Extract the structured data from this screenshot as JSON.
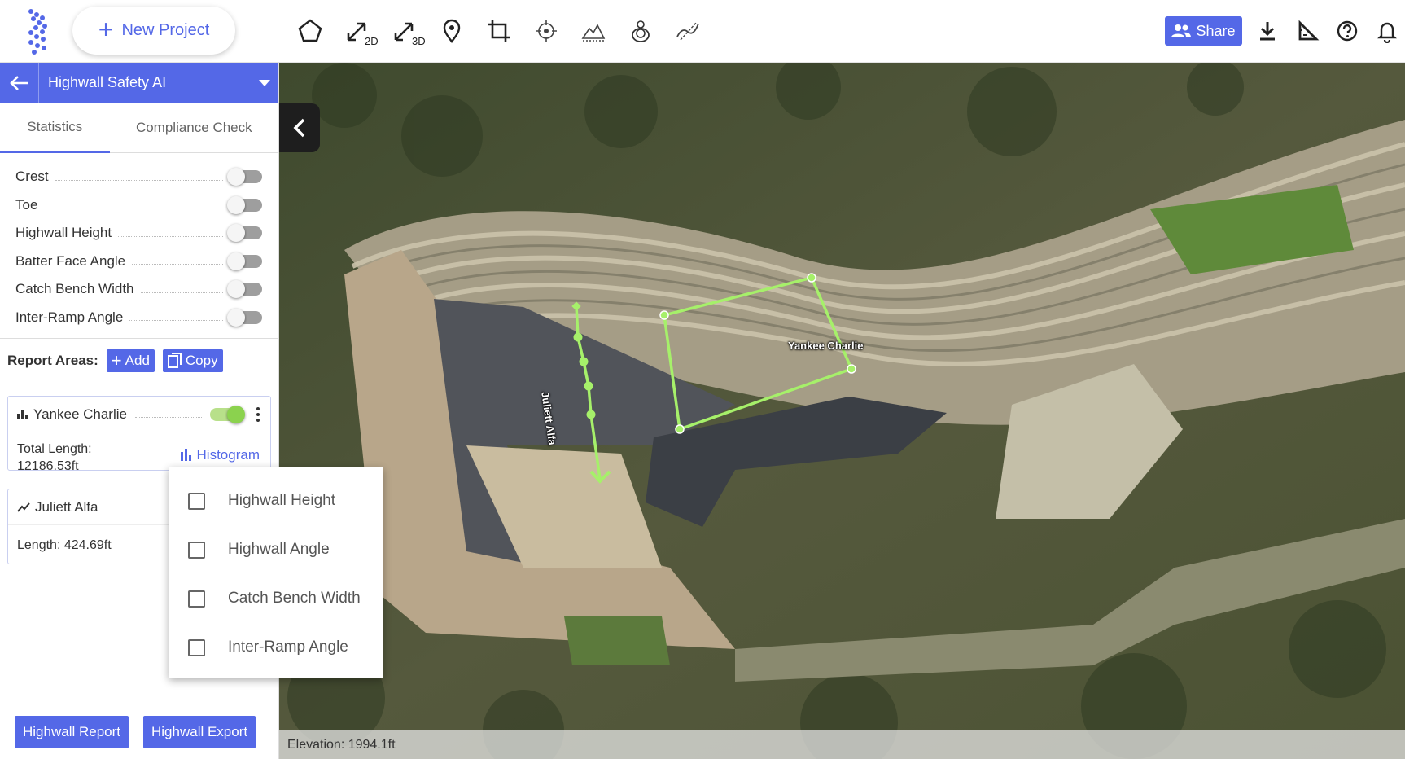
{
  "topbar": {
    "new_project_label": "New Project",
    "tools": [
      {
        "name": "polygon-tool-icon",
        "sub": ""
      },
      {
        "name": "measure-2d-icon",
        "sub": "2D"
      },
      {
        "name": "measure-3d-icon",
        "sub": "3D"
      },
      {
        "name": "location-pin-icon",
        "sub": ""
      },
      {
        "name": "crop-icon",
        "sub": ""
      },
      {
        "name": "target-icon",
        "sub": ""
      },
      {
        "name": "volume-icon",
        "sub": ""
      },
      {
        "name": "stockpile-icon",
        "sub": ""
      },
      {
        "name": "profile-line-icon",
        "sub": ""
      }
    ],
    "share_label": "Share"
  },
  "sidebar": {
    "project_title": "Highwall Safety AI",
    "tabs": [
      {
        "label": "Statistics",
        "active": true
      },
      {
        "label": "Compliance Check",
        "active": false
      }
    ],
    "toggles": [
      {
        "label": "Crest",
        "on": false
      },
      {
        "label": "Toe",
        "on": false
      },
      {
        "label": "Highwall Height",
        "on": false
      },
      {
        "label": "Batter Face Angle",
        "on": false
      },
      {
        "label": "Catch Bench Width",
        "on": false
      },
      {
        "label": "Inter-Ramp Angle",
        "on": false
      }
    ],
    "report_areas_label": "Report Areas:",
    "add_label": "Add",
    "copy_label": "Copy",
    "cards": [
      {
        "name": "Yankee Charlie",
        "detail_label": "Total Length:",
        "detail_value": "12186.53ft",
        "link": "Histogram",
        "on": true
      },
      {
        "name": "Juliett Alfa",
        "detail_label": "Length:",
        "detail_value": "424.69ft"
      }
    ],
    "report_button": "Highwall Report",
    "export_button": "Highwall Export"
  },
  "dropdown": {
    "items": [
      "Highwall Height",
      "Highwall Angle",
      "Catch Bench Width",
      "Inter-Ramp Angle"
    ]
  },
  "map": {
    "labels": {
      "area": "Yankee Charlie",
      "line": "Juliett Alfa"
    },
    "elevation": "Elevation: 1994.1ft",
    "overlay_color": "#a6f06a"
  }
}
